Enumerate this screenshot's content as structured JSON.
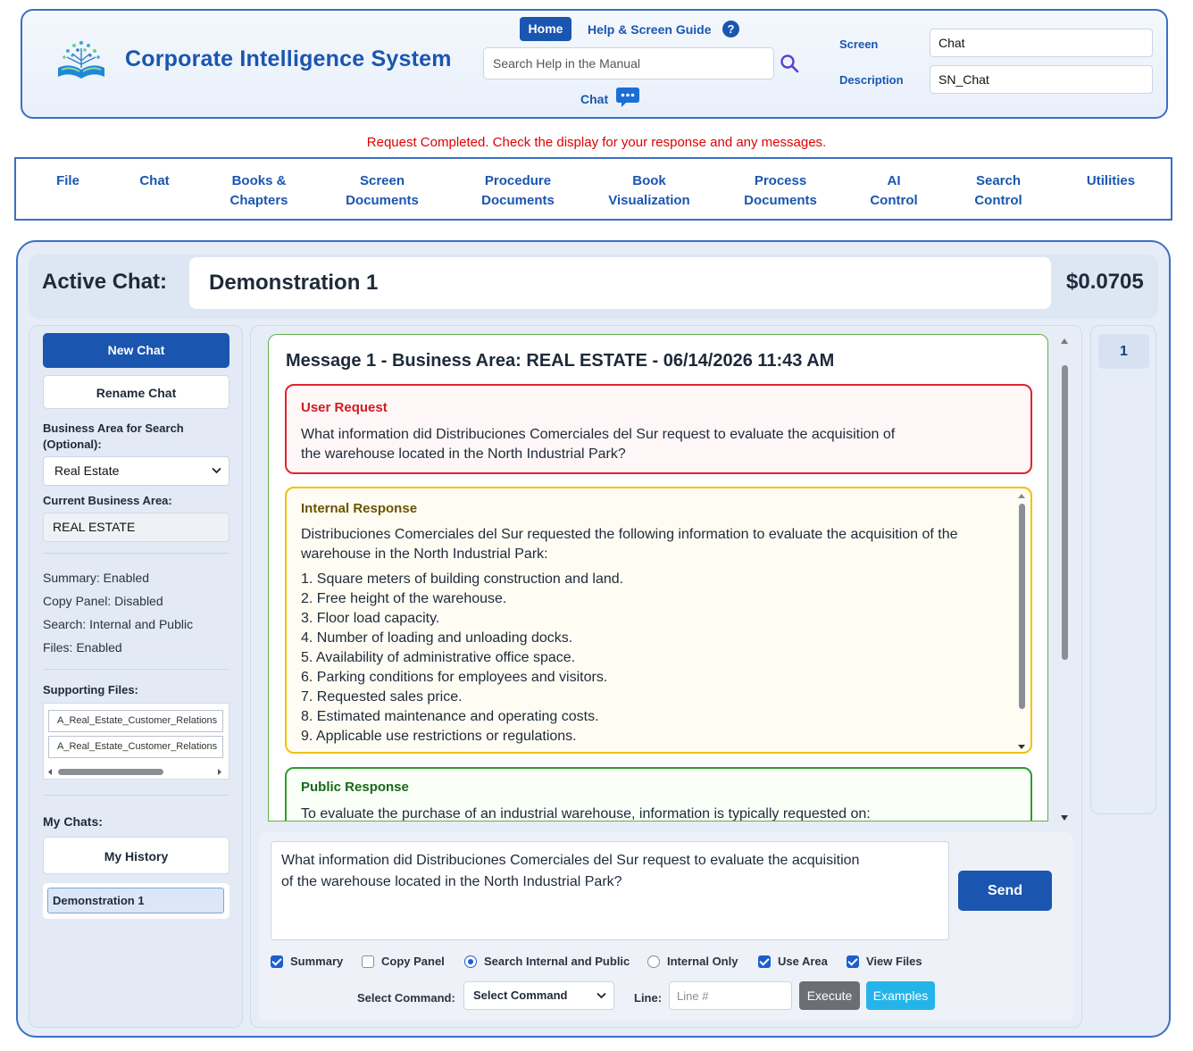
{
  "app": {
    "title": "Corporate Intelligence System"
  },
  "header": {
    "home_label": "Home",
    "help_label": "Help & Screen Guide",
    "help_icon_glyph": "?",
    "search_placeholder": "Search Help in the Manual",
    "chat_label": "Chat",
    "screen_label": "Screen",
    "screen_value": "Chat",
    "description_label": "Description",
    "description_value": "SN_Chat",
    "accent_color": "#1a56b0"
  },
  "status_message": "Request Completed. Check the display for your response and any messages.",
  "menu": [
    {
      "label": "File"
    },
    {
      "label": "Chat"
    },
    {
      "label": "Books &\nChapters"
    },
    {
      "label": "Screen\nDocuments"
    },
    {
      "label": "Procedure\nDocuments"
    },
    {
      "label": "Book\nVisualization"
    },
    {
      "label": "Process\nDocuments"
    },
    {
      "label": "AI\nControl"
    },
    {
      "label": "Search\nControl"
    },
    {
      "label": "Utilities"
    }
  ],
  "active_chat": {
    "label": "Active Chat:",
    "name": "Demonstration 1",
    "cost": "$0.0705"
  },
  "sidebar": {
    "new_chat_label": "New Chat",
    "rename_chat_label": "Rename Chat",
    "business_area_label": "Business Area for Search\n(Optional):",
    "business_area_selected": "Real Estate",
    "current_area_label": "Current Business Area:",
    "current_area_value": "REAL ESTATE",
    "status_lines": [
      "Summary: Enabled",
      "Copy Panel: Disabled",
      "Search: Internal and Public",
      "Files: Enabled"
    ],
    "supporting_files_label": "Supporting Files:",
    "files": [
      "A_Real_Estate_Customer_Relations",
      "A_Real_Estate_Customer_Relations"
    ],
    "my_chats_label": "My Chats:",
    "my_history_label": "My History",
    "chats": [
      "Demonstration 1"
    ]
  },
  "message": {
    "header": "Message 1 - Business Area: REAL ESTATE - 06/14/2026 11:43 AM",
    "user_request_title": "User Request",
    "user_request_text": "What information did Distribuciones Comerciales del Sur request to evaluate the acquisition of the warehouse located in the North Industrial Park?",
    "internal_title": "Internal Response",
    "internal_intro": "Distribuciones Comerciales del Sur requested the following information to evaluate the acquisition of the warehouse in the North Industrial Park:",
    "internal_items": [
      "1. Square meters of building construction and land.",
      "2. Free height of the warehouse.",
      "3. Floor load capacity.",
      "4. Number of loading and unloading docks.",
      "5. Availability of administrative office space.",
      "6. Parking conditions for employees and visitors.",
      "7. Requested sales price.",
      "8. Estimated maintenance and operating costs.",
      "9. Applicable use restrictions or regulations."
    ],
    "public_title": "Public Response",
    "public_text": "To evaluate the purchase of an industrial warehouse, information is typically requested on:"
  },
  "input": {
    "text": "What information did Distribuciones Comerciales del Sur request to evaluate the acquisition\nof the warehouse located in the North Industrial Park?",
    "send_label": "Send",
    "options": {
      "summary": "Summary",
      "copy_panel": "Copy Panel",
      "search_internal_public": "Search Internal and Public",
      "internal_only": "Internal Only",
      "use_area": "Use Area",
      "view_files": "View Files"
    },
    "select_command_label": "Select Command:",
    "select_command_value": "Select Command",
    "line_label": "Line:",
    "line_placeholder": "Line #",
    "execute_label": "Execute",
    "examples_label": "Examples"
  },
  "right_panel": {
    "page_number": "1"
  },
  "colors": {
    "user_request_border": "#e0242e",
    "internal_border": "#f2c200",
    "public_border": "#2f9a2f",
    "status_red": "#e00000",
    "examples_cyan": "#25b4ea"
  }
}
